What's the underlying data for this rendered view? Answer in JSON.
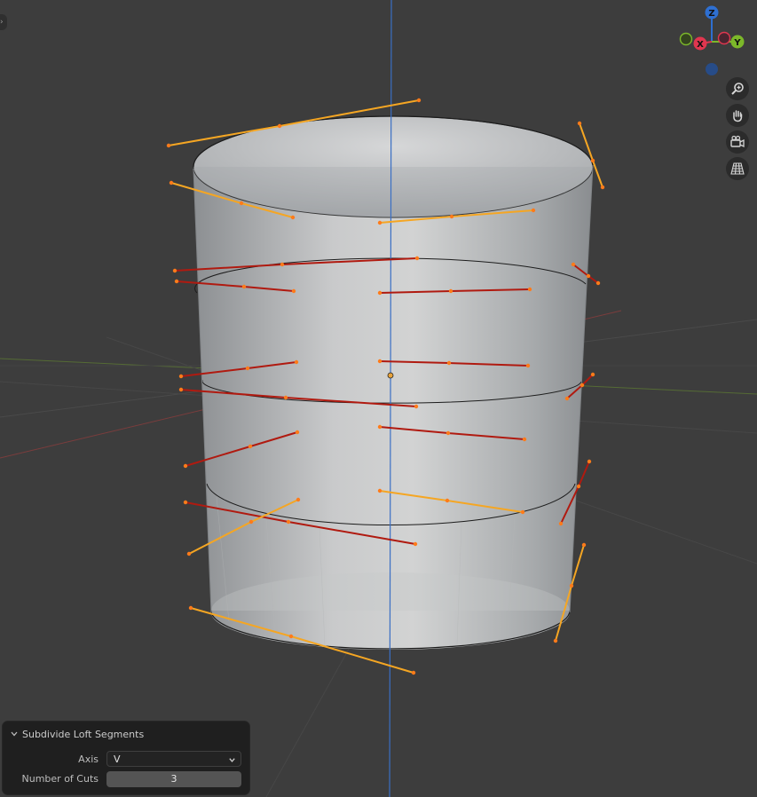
{
  "gizmo": {
    "z_label": "Z",
    "x_label": "X",
    "y_label": "Y",
    "z_color": "#2e6fd1",
    "x_color": "#e0364f",
    "y_color": "#7cb82a"
  },
  "nav_buttons": [
    {
      "name": "zoom-icon"
    },
    {
      "name": "hand-pan-icon"
    },
    {
      "name": "camera-icon"
    },
    {
      "name": "perspective-grid-icon"
    }
  ],
  "operator_panel": {
    "title": "Subdivide Loft Segments",
    "axis_label": "Axis",
    "axis_value": "V",
    "cuts_label": "Number of Cuts",
    "cuts_value": "3"
  },
  "colors": {
    "background": "#3d3d3d",
    "selected_curve": "#f5a623",
    "unselected_curve": "#b01a10",
    "vertex": "#ff7b1a"
  }
}
